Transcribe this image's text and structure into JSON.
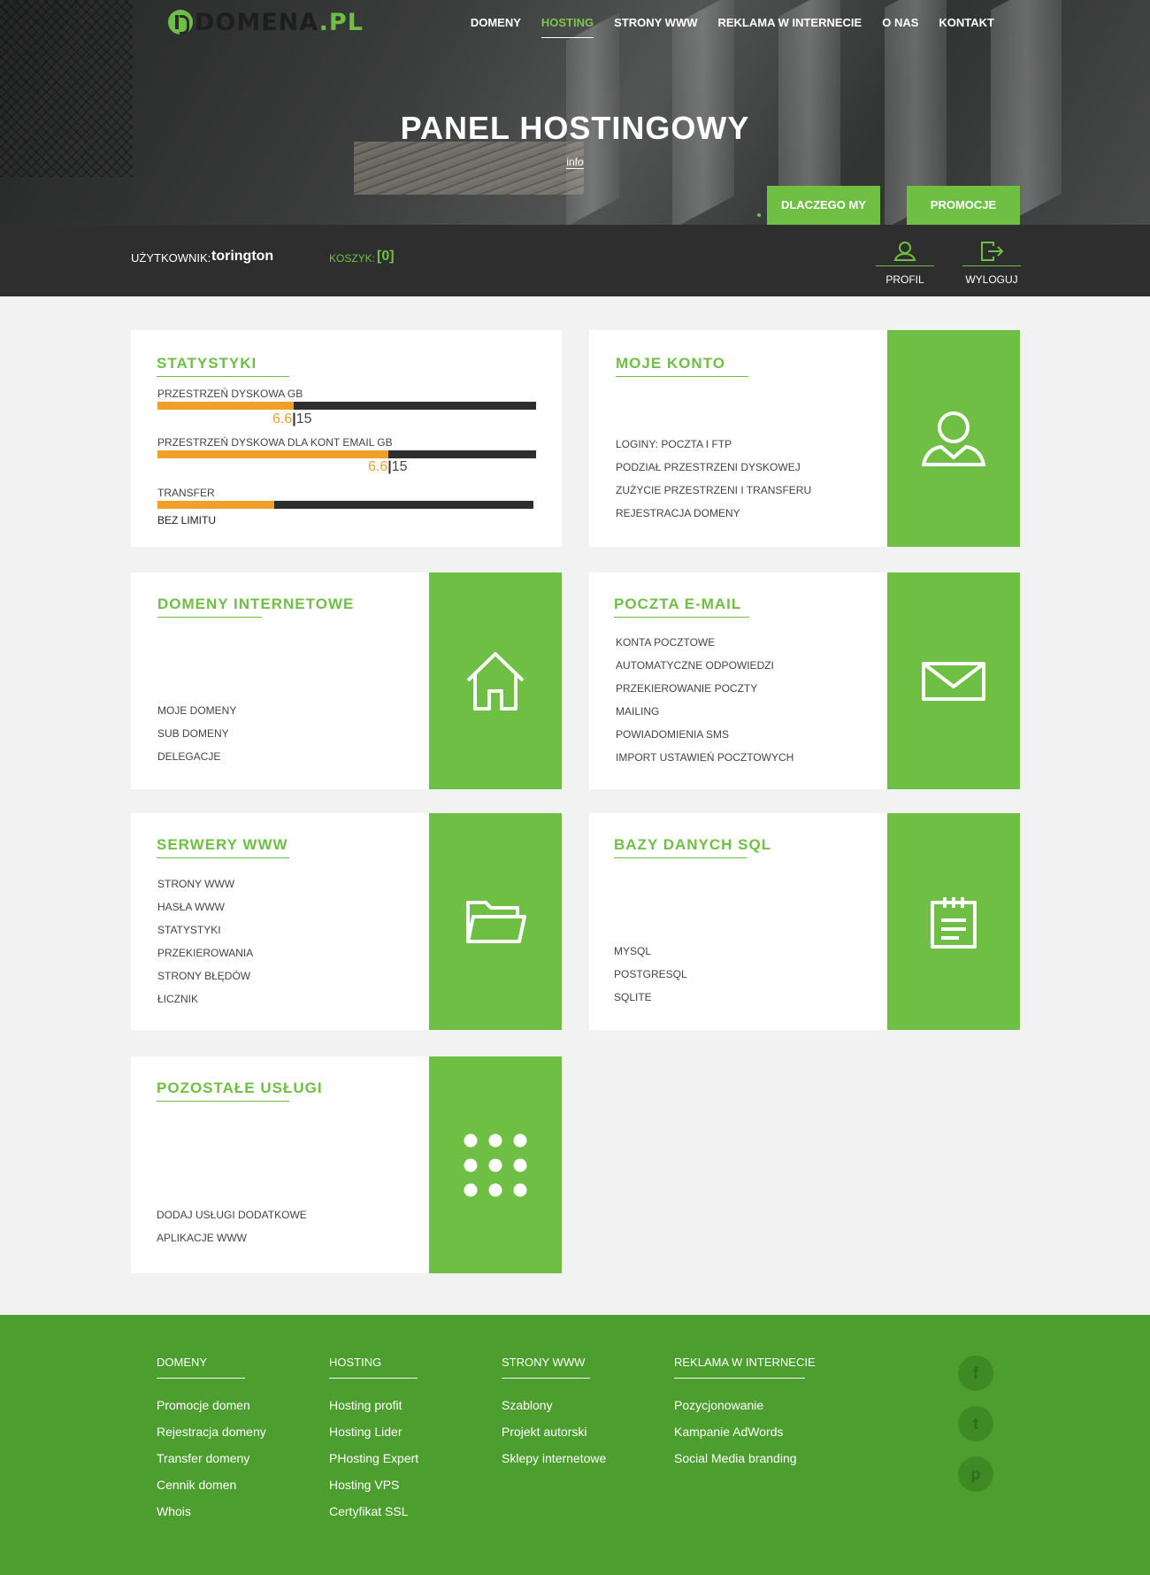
{
  "brand": {
    "name": "domena",
    "tld": ".pl",
    "green": "#6fbf44",
    "dark": "#2e2e2e",
    "accent": "#f0a028"
  },
  "nav": {
    "items": [
      {
        "label": "DOMENY"
      },
      {
        "label": "HOSTING",
        "active": true
      },
      {
        "label": "STRONY WWW"
      },
      {
        "label": "REKLAMA W INTERNECIE"
      },
      {
        "label": "O NAS"
      },
      {
        "label": "KONTAKT"
      }
    ]
  },
  "hero": {
    "title": "PANEL HOSTINGOWY",
    "info": "info",
    "btn_why": "DLACZEGO MY",
    "btn_promo": "PROMOCJE"
  },
  "userbar": {
    "user_label": "UŻYTKOWNIK:",
    "user_name": "torington",
    "cart_label": "KOSZYK:",
    "cart_value": "[0]",
    "profile_label": "PROFIL",
    "profile_icon": "user-icon",
    "logout_label": "WYLOGUJ",
    "logout_icon": "logout-icon"
  },
  "stats": {
    "title": "STATYSTYKI",
    "disk": {
      "label": "PRZESTRZEŃ DYSKOWA GB",
      "used": "6.6",
      "sep": "|",
      "total": "15",
      "fraction": 0.36
    },
    "email": {
      "label": "PRZESTRZEŃ DYSKOWA DLA KONT EMAIL GB",
      "used": "6.6",
      "sep": "|",
      "total": "15",
      "fraction": 0.61
    },
    "transfer": {
      "label": "TRANSFER",
      "value": "BEZ LIMITU",
      "fraction": 0.31
    }
  },
  "account": {
    "title": "MOJE KONTO",
    "icon": "user-icon",
    "items": [
      "LOGINY: POCZTA I FTP",
      "PODZIAŁ PRZESTRZENI DYSKOWEJ",
      "ZUŻYCIE PRZESTRZENI I TRANSFERU",
      "REJESTRACJA DOMENY"
    ]
  },
  "domains": {
    "title": "DOMENY INTERNETOWE",
    "icon": "home-icon",
    "items": [
      "MOJE DOMENY",
      "SUB DOMENY",
      "DELEGACJE"
    ]
  },
  "mail": {
    "title": "POCZTA E-MAIL",
    "icon": "envelope-icon",
    "items": [
      "KONTA POCZTOWE",
      "AUTOMATYCZNE ODPOWIEDZI",
      "PRZEKIEROWANIE POCZTY",
      "MAILING",
      "POWIADOMIENIA SMS",
      "IMPORT USTAWIEŃ POCZTOWYCH"
    ]
  },
  "www": {
    "title": "SERWERY WWW",
    "icon": "folder-icon",
    "items": [
      "STRONY WWW",
      "HASŁA WWW",
      "STATYSTYKI",
      "PRZEKIEROWANIA",
      "STRONY BŁĘDÓW",
      "ŁICZNIK"
    ]
  },
  "sql": {
    "title": "BAZY DANYCH SQL",
    "icon": "clipboard-icon",
    "items": [
      "MYSQL",
      "POSTGRESQL",
      "SQLITE"
    ]
  },
  "other": {
    "title": "POZOSTAŁE USŁUGI",
    "icon": "grid-dots-icon",
    "items": [
      "DODAJ USŁUGI DODATKOWE",
      "APLIKACJE WWW"
    ]
  },
  "footer": {
    "cols": [
      {
        "title": "DOMENY",
        "links": [
          "Promocje domen",
          "Rejestracja domeny",
          "Transfer domeny",
          "Cennik domen",
          "Whois"
        ]
      },
      {
        "title": "HOSTING",
        "links": [
          "Hosting profit",
          "Hosting Lider",
          "PHosting Expert",
          "Hosting VPS",
          "Certyfikat SSL"
        ]
      },
      {
        "title": "STRONY WWW",
        "links": [
          "Szablony",
          "Projekt autorski",
          "Sklepy internetowe"
        ]
      },
      {
        "title": "REKLAMA W INTERNECIE",
        "links": [
          "Pozycjonowanie",
          "Kampanie AdWords",
          "Social Media branding"
        ]
      }
    ],
    "social": [
      {
        "label": "f",
        "icon": "facebook-icon"
      },
      {
        "label": "t",
        "icon": "twitter-icon"
      },
      {
        "label": "p",
        "icon": "pinterest-icon"
      }
    ]
  }
}
